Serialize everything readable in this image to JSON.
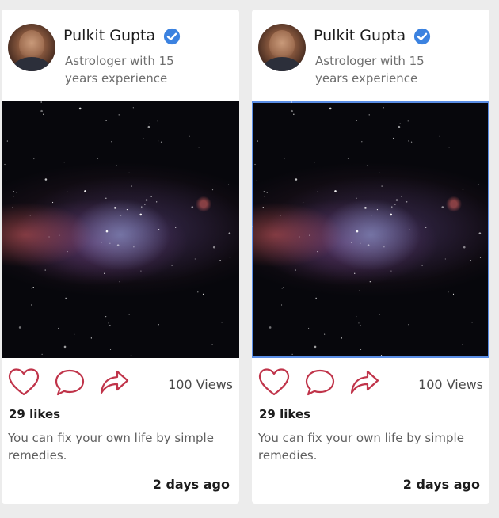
{
  "posts": [
    {
      "author": "Pulkit Gupta",
      "subtitle": "Astrologer with 15 years experience",
      "views": "100 Views",
      "likes": "29 likes",
      "caption": "You can fix your own life by simple remedies.",
      "time": "2 days ago"
    },
    {
      "author": "Pulkit Gupta",
      "subtitle": "Astrologer with 15 years experience",
      "views": "100 Views",
      "likes": "29 likes",
      "caption": "You can fix your own life by simple remedies.",
      "time": "2 days ago"
    }
  ],
  "colors": {
    "verified": "#3b82e0",
    "action_icon": "#c0344a",
    "selection_border": "#5a8ee6"
  },
  "icons": [
    "verified-badge-icon",
    "heart-icon",
    "comment-icon",
    "share-icon"
  ]
}
